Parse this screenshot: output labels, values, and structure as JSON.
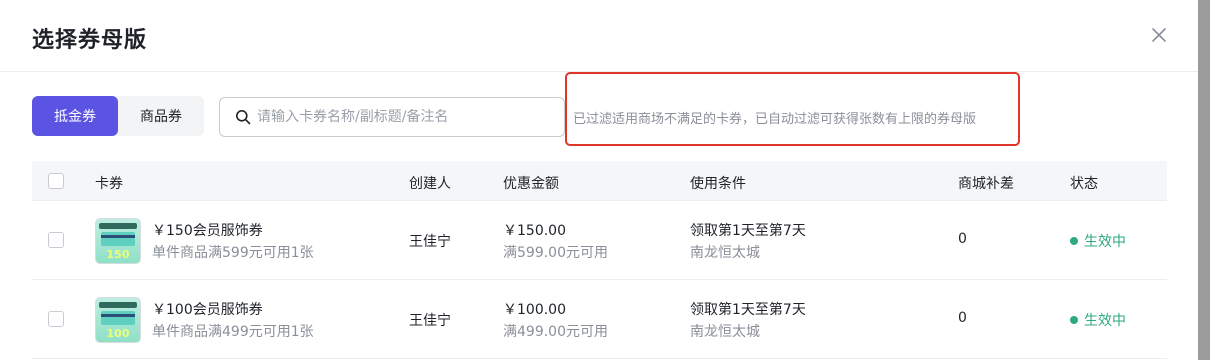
{
  "dialog": {
    "title": "选择券母版",
    "close_icon": "close-icon"
  },
  "toolbar": {
    "tabs": [
      {
        "label": "抵金券",
        "active": true
      },
      {
        "label": "商品券",
        "active": false
      }
    ],
    "search": {
      "placeholder": "请输入卡券名称/副标题/备注名",
      "value": ""
    },
    "hint": "已过滤适用商场不满足的卡券，已自动过滤可获得张数有上限的券母版"
  },
  "colors": {
    "accent": "#5b54e3",
    "status_active": "#2faa7c",
    "highlight_border": "#e0352b"
  },
  "table": {
    "columns": [
      "卡券",
      "创建人",
      "优惠金额",
      "使用条件",
      "商城补差",
      "状态"
    ],
    "rows": [
      {
        "name": "￥150会员服饰券",
        "desc": "单件商品满599元可用1张",
        "thumb_amount": "150",
        "creator": "王佳宁",
        "discount": "￥150.00",
        "threshold": "满599.00元可用",
        "condition": "领取第1天至第7天",
        "mall": "南龙恒太城",
        "subsidy": "0",
        "status": "生效中"
      },
      {
        "name": "￥100会员服饰券",
        "desc": "单件商品满499元可用1张",
        "thumb_amount": "100",
        "creator": "王佳宁",
        "discount": "￥100.00",
        "threshold": "满499.00元可用",
        "condition": "领取第1天至第7天",
        "mall": "南龙恒太城",
        "subsidy": "0",
        "status": "生效中"
      }
    ]
  }
}
